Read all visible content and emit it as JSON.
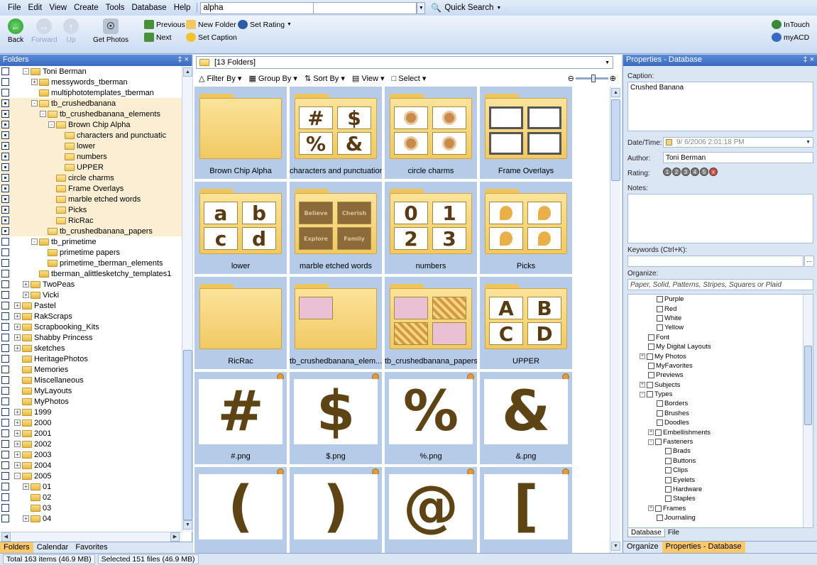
{
  "menu": {
    "items": [
      "File",
      "Edit",
      "View",
      "Create",
      "Tools",
      "Database",
      "Help"
    ],
    "address": "alpha",
    "quick_search": "Quick Search"
  },
  "toolbar": {
    "back": "Back",
    "forward": "Forward",
    "up": "Up",
    "get_photos": "Get Photos",
    "previous": "Previous",
    "next": "Next",
    "new_folder": "New Folder",
    "set_caption": "Set Caption",
    "set_rating": "Set Rating",
    "intouch": "InTouch",
    "myacd": "myACD"
  },
  "folders_panel": {
    "title": "Folders",
    "tree": [
      {
        "label": "Toni Berman",
        "indent": 1,
        "exp": "-",
        "cb": "empty",
        "hl": false
      },
      {
        "label": "messywords_tberman",
        "indent": 2,
        "exp": "+",
        "cb": "empty",
        "hl": false
      },
      {
        "label": "multiphototemplates_tberman",
        "indent": 2,
        "exp": "",
        "cb": "empty",
        "hl": false
      },
      {
        "label": "tb_crushedbanana",
        "indent": 2,
        "exp": "-",
        "cb": "part",
        "hl": true
      },
      {
        "label": "tb_crushedbanana_elements",
        "indent": 3,
        "exp": "-",
        "cb": "part",
        "hl": true
      },
      {
        "label": "Brown Chip Alpha",
        "indent": 4,
        "exp": "-",
        "cb": "part",
        "hl": true
      },
      {
        "label": "characters and punctuatic",
        "indent": 5,
        "exp": "",
        "cb": "part",
        "hl": true
      },
      {
        "label": "lower",
        "indent": 5,
        "exp": "",
        "cb": "part",
        "hl": true
      },
      {
        "label": "numbers",
        "indent": 5,
        "exp": "",
        "cb": "part",
        "hl": true
      },
      {
        "label": "UPPER",
        "indent": 5,
        "exp": "",
        "cb": "part",
        "hl": true
      },
      {
        "label": "circle charms",
        "indent": 4,
        "exp": "",
        "cb": "part",
        "hl": true
      },
      {
        "label": "Frame Overlays",
        "indent": 4,
        "exp": "",
        "cb": "part",
        "hl": true
      },
      {
        "label": "marble etched words",
        "indent": 4,
        "exp": "",
        "cb": "part",
        "hl": true
      },
      {
        "label": "Picks",
        "indent": 4,
        "exp": "",
        "cb": "part",
        "hl": true
      },
      {
        "label": "RicRac",
        "indent": 4,
        "exp": "",
        "cb": "part",
        "hl": true
      },
      {
        "label": "tb_crushedbanana_papers",
        "indent": 3,
        "exp": "",
        "cb": "part",
        "hl": true
      },
      {
        "label": "tb_primetime",
        "indent": 2,
        "exp": "-",
        "cb": "empty",
        "hl": false
      },
      {
        "label": "primetime papers",
        "indent": 3,
        "exp": "",
        "cb": "empty",
        "hl": false
      },
      {
        "label": "primetime_tberman_elements",
        "indent": 3,
        "exp": "",
        "cb": "empty",
        "hl": false
      },
      {
        "label": "tberman_alittlesketchy_templates1",
        "indent": 2,
        "exp": "",
        "cb": "empty",
        "hl": false
      },
      {
        "label": "TwoPeas",
        "indent": 1,
        "exp": "+",
        "cb": "empty",
        "hl": false
      },
      {
        "label": "Vicki",
        "indent": 1,
        "exp": "+",
        "cb": "empty",
        "hl": false
      },
      {
        "label": "Pastel",
        "indent": 0,
        "exp": "+",
        "cb": "empty",
        "hl": false
      },
      {
        "label": "RakScraps",
        "indent": 0,
        "exp": "+",
        "cb": "empty",
        "hl": false
      },
      {
        "label": "Scrapbooking_Kits",
        "indent": 0,
        "exp": "+",
        "cb": "empty",
        "hl": false
      },
      {
        "label": "Shabby Princess",
        "indent": 0,
        "exp": "+",
        "cb": "empty",
        "hl": false
      },
      {
        "label": "sketches",
        "indent": 0,
        "exp": "+",
        "cb": "empty",
        "hl": false
      },
      {
        "label": "HeritagePhotos",
        "indent": 0,
        "exp": "",
        "cb": "empty",
        "hl": false
      },
      {
        "label": "Memories",
        "indent": 0,
        "exp": "",
        "cb": "empty",
        "hl": false
      },
      {
        "label": "Miscellaneous",
        "indent": 0,
        "exp": "",
        "cb": "empty",
        "hl": false
      },
      {
        "label": "MyLayouts",
        "indent": 0,
        "exp": "",
        "cb": "empty",
        "hl": false
      },
      {
        "label": "MyPhotos",
        "indent": 0,
        "exp": "",
        "cb": "empty",
        "hl": false
      },
      {
        "label": "1999",
        "indent": 0,
        "exp": "+",
        "cb": "empty",
        "hl": false
      },
      {
        "label": "2000",
        "indent": 0,
        "exp": "+",
        "cb": "empty",
        "hl": false
      },
      {
        "label": "2001",
        "indent": 0,
        "exp": "+",
        "cb": "empty",
        "hl": false
      },
      {
        "label": "2002",
        "indent": 0,
        "exp": "+",
        "cb": "empty",
        "hl": false
      },
      {
        "label": "2003",
        "indent": 0,
        "exp": "+",
        "cb": "empty",
        "hl": false
      },
      {
        "label": "2004",
        "indent": 0,
        "exp": "+",
        "cb": "empty",
        "hl": false
      },
      {
        "label": "2005",
        "indent": 0,
        "exp": "-",
        "cb": "empty",
        "hl": false
      },
      {
        "label": "01",
        "indent": 1,
        "exp": "+",
        "cb": "empty",
        "hl": false
      },
      {
        "label": "02",
        "indent": 1,
        "exp": "",
        "cb": "empty",
        "hl": false
      },
      {
        "label": "03",
        "indent": 1,
        "exp": "",
        "cb": "empty",
        "hl": false
      },
      {
        "label": "04",
        "indent": 1,
        "exp": "+",
        "cb": "empty",
        "hl": false
      }
    ],
    "tabs": [
      "Folders",
      "Calendar",
      "Favorites"
    ]
  },
  "browser": {
    "path": "[13 Folders]",
    "toolbar": [
      "Filter By",
      "Group By",
      "Sort By",
      "View",
      "Select"
    ],
    "items": [
      {
        "label": "Brown Chip Alpha",
        "kind": "folder",
        "chars": [
          "",
          "",
          "",
          ""
        ],
        "style": "blank"
      },
      {
        "label": "characters and punctuation",
        "kind": "folder",
        "chars": [
          "#",
          "$",
          "%",
          "&"
        ],
        "style": "glyph"
      },
      {
        "label": "circle charms",
        "kind": "folder",
        "chars": [
          "",
          "",
          "",
          ""
        ],
        "style": "charm"
      },
      {
        "label": "Frame Overlays",
        "kind": "folder",
        "chars": [
          "",
          "",
          "",
          ""
        ],
        "style": "frame"
      },
      {
        "label": "lower",
        "kind": "folder",
        "chars": [
          "a",
          "b",
          "c",
          "d"
        ],
        "style": "glyph"
      },
      {
        "label": "marble etched words",
        "kind": "folder",
        "chars": [
          "Believe",
          "Cherish",
          "Explore",
          "Family"
        ],
        "style": "word"
      },
      {
        "label": "numbers",
        "kind": "folder",
        "chars": [
          "0",
          "1",
          "2",
          "3"
        ],
        "style": "glyph"
      },
      {
        "label": "Picks",
        "kind": "folder",
        "chars": [
          "",
          "",
          "",
          ""
        ],
        "style": "pick"
      },
      {
        "label": "RicRac",
        "kind": "folder",
        "chars": [
          "",
          "",
          "",
          ""
        ],
        "style": "ricrac"
      },
      {
        "label": "tb_crushedbanana_elem...",
        "kind": "folder",
        "chars": [
          "",
          "",
          "",
          ""
        ],
        "style": "elem"
      },
      {
        "label": "tb_crushedbanana_papers",
        "kind": "folder",
        "chars": [
          "",
          "",
          "",
          ""
        ],
        "style": "paper"
      },
      {
        "label": "UPPER",
        "kind": "folder",
        "chars": [
          "A",
          "B",
          "C",
          "D"
        ],
        "style": "glyph"
      },
      {
        "label": "#.png",
        "kind": "image",
        "chars": [
          "#"
        ]
      },
      {
        "label": "$.png",
        "kind": "image",
        "chars": [
          "$"
        ]
      },
      {
        "label": "%.png",
        "kind": "image",
        "chars": [
          "%"
        ]
      },
      {
        "label": "&.png",
        "kind": "image",
        "chars": [
          "&"
        ]
      },
      {
        "label": "",
        "kind": "image",
        "chars": [
          "("
        ]
      },
      {
        "label": "",
        "kind": "image",
        "chars": [
          ")"
        ]
      },
      {
        "label": "",
        "kind": "image",
        "chars": [
          "@"
        ]
      },
      {
        "label": "",
        "kind": "image",
        "chars": [
          "["
        ]
      }
    ]
  },
  "properties": {
    "title": "Properties - Database",
    "caption_label": "Caption:",
    "caption": "Crushed Banana",
    "datetime_label": "Date/Time:",
    "datetime": "9/ 6/2006  2:01:18 PM",
    "author_label": "Author:",
    "author": "Toni Berman",
    "rating_label": "Rating:",
    "rating_buttons": [
      "1",
      "2",
      "3",
      "4",
      "5",
      "x"
    ],
    "notes_label": "Notes:",
    "keywords_label": "Keywords (Ctrl+K):",
    "organize_label": "Organize:",
    "organize_value": "Paper, Solid, Patterns, Stripes, Squares or Plaid",
    "categories": [
      {
        "label": "Purple",
        "indent": 3,
        "exp": ""
      },
      {
        "label": "Red",
        "indent": 3,
        "exp": ""
      },
      {
        "label": "White",
        "indent": 3,
        "exp": ""
      },
      {
        "label": "Yellow",
        "indent": 3,
        "exp": ""
      },
      {
        "label": "Font",
        "indent": 2,
        "exp": ""
      },
      {
        "label": "My Digital Layouts",
        "indent": 2,
        "exp": ""
      },
      {
        "label": "My Photos",
        "indent": 1,
        "exp": "+"
      },
      {
        "label": "MyFavorites",
        "indent": 2,
        "exp": ""
      },
      {
        "label": "Previews",
        "indent": 2,
        "exp": ""
      },
      {
        "label": "Subjects",
        "indent": 1,
        "exp": "+"
      },
      {
        "label": "Types",
        "indent": 1,
        "exp": "-"
      },
      {
        "label": "Borders",
        "indent": 3,
        "exp": ""
      },
      {
        "label": "Brushes",
        "indent": 3,
        "exp": ""
      },
      {
        "label": "Doodles",
        "indent": 3,
        "exp": ""
      },
      {
        "label": "Embellishments",
        "indent": 2,
        "exp": "+"
      },
      {
        "label": "Fasteners",
        "indent": 2,
        "exp": "-"
      },
      {
        "label": "Brads",
        "indent": 4,
        "exp": ""
      },
      {
        "label": "Buttons",
        "indent": 4,
        "exp": ""
      },
      {
        "label": "Clips",
        "indent": 4,
        "exp": ""
      },
      {
        "label": "Eyelets",
        "indent": 4,
        "exp": ""
      },
      {
        "label": "Hardware",
        "indent": 4,
        "exp": ""
      },
      {
        "label": "Staples",
        "indent": 4,
        "exp": ""
      },
      {
        "label": "Frames",
        "indent": 2,
        "exp": "+"
      },
      {
        "label": "Journaling",
        "indent": 3,
        "exp": ""
      }
    ],
    "subtabs": [
      "Database",
      "File"
    ],
    "bottom_tabs": [
      "Organize",
      "Properties - Database"
    ]
  },
  "status": {
    "total": "Total 163 items  (46.9 MB)",
    "selected": "Selected 151 files (46.9 MB)"
  },
  "colors": {
    "accent": "#fcc96a",
    "highlight": "#fbeed3",
    "header": "#3a6ac0",
    "tile": "#b6cbe8",
    "glyph": "#5a3a12"
  }
}
